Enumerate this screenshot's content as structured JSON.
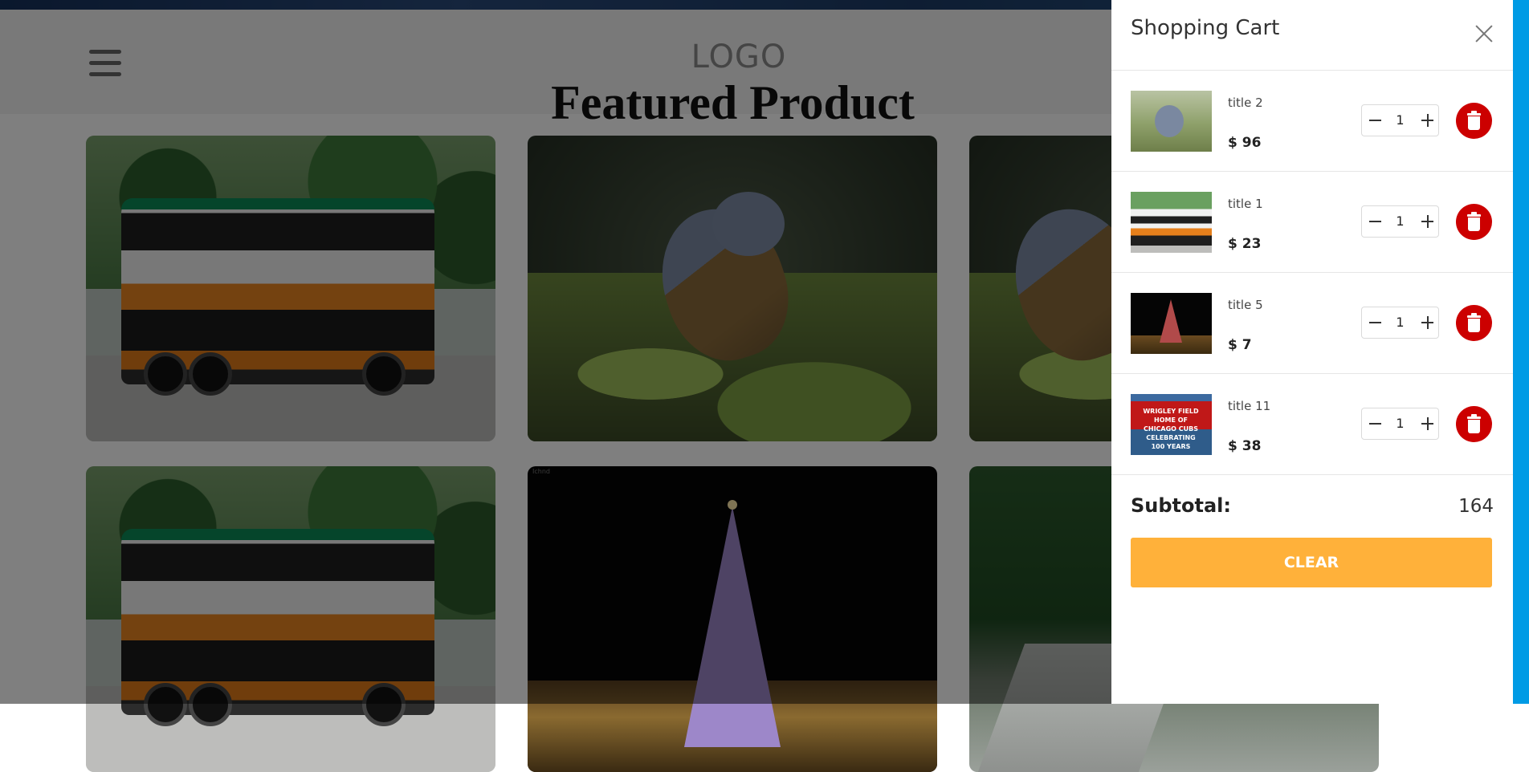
{
  "header": {
    "logo": "LOGO",
    "section_title": "Featured Product"
  },
  "products": [
    {
      "image": "bus",
      "label": ""
    },
    {
      "image": "bird",
      "label": ""
    },
    {
      "image": "bird",
      "label": ""
    },
    {
      "image": "bus",
      "label": ""
    },
    {
      "image": "christmas-tree",
      "label": "Ichnd"
    },
    {
      "image": "bridge",
      "label": ""
    }
  ],
  "cart": {
    "title": "Shopping Cart",
    "items": [
      {
        "title": "title 2",
        "price": "$ 96",
        "quantity": "1",
        "image": "bird"
      },
      {
        "title": "title 1",
        "price": "$ 23",
        "quantity": "1",
        "image": "bus"
      },
      {
        "title": "title 5",
        "price": "$ 7",
        "quantity": "1",
        "image": "christmas-tree"
      },
      {
        "title": "title 11",
        "price": "$ 38",
        "quantity": "1",
        "image": "wrigley-field-sign",
        "sign_text": "WRIGLEY FIELD HOME OF CHICAGO CUBS CELEBRATING 100 YEARS"
      }
    ],
    "subtotal_label": "Subtotal:",
    "subtotal_value": "164",
    "clear_label": "CLEAR"
  },
  "colors": {
    "delete": "#cc0000",
    "clear_button": "#ffb13a",
    "scroll_bar": "#009be5",
    "overlay": "rgba(0,0,0,0.5)"
  }
}
